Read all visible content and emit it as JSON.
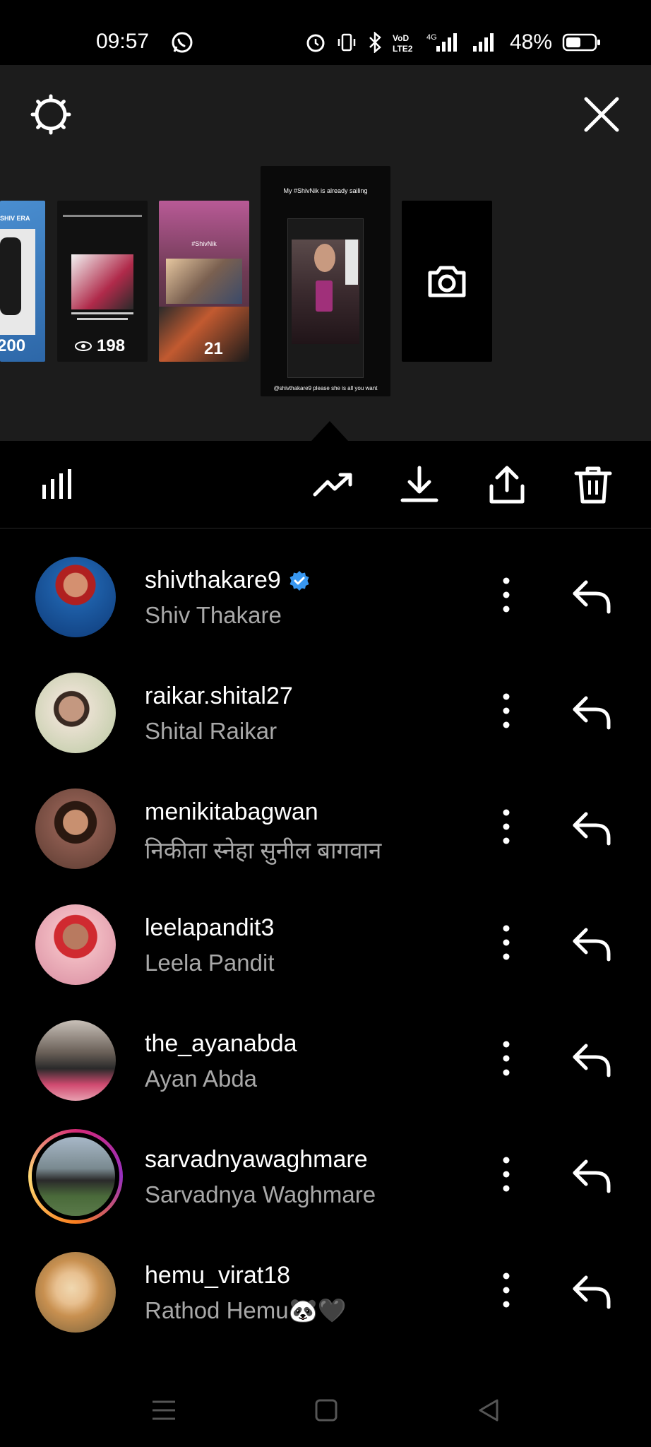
{
  "status_bar": {
    "time": "09:57",
    "battery_percent": "48%",
    "icons": [
      "whatsapp-icon",
      "alarm-icon",
      "vibrate-icon",
      "bluetooth-icon",
      "volte-icon",
      "4g-signal-icon",
      "signal-icon",
      "battery-icon"
    ],
    "network_label": "4G",
    "volte_label": "VoLTE2"
  },
  "story_panel": {
    "thumbnails": [
      {
        "id": "thumb-1",
        "view_count": "200",
        "caption": "SHIV ERA"
      },
      {
        "id": "thumb-2",
        "view_count": "198"
      },
      {
        "id": "thumb-3",
        "view_count": "21",
        "caption": "#ShivNik"
      },
      {
        "id": "thumb-4",
        "caption_top": "My #ShivNik is already sailing",
        "caption_bottom": "@shivthakare9 please she is all you want"
      },
      {
        "id": "thumb-5",
        "icon": "camera-icon"
      }
    ]
  },
  "action_bar": {
    "icons": [
      "insights-bars-icon",
      "trending-icon",
      "download-icon",
      "share-icon",
      "delete-icon"
    ]
  },
  "viewers": [
    {
      "username": "shivthakare9",
      "full_name": "Shiv Thakare",
      "verified": true,
      "ring": false,
      "avatar_color": "#1e5fa8"
    },
    {
      "username": "raikar.shital27",
      "full_name": "Shital Raikar",
      "verified": false,
      "ring": false,
      "avatar_color": "#c8b8a0"
    },
    {
      "username": "menikitabagwan",
      "full_name": "निकीता  स्नेहा सुनील  बागवान",
      "verified": false,
      "ring": false,
      "avatar_color": "#7a4a3e"
    },
    {
      "username": "leelapandit3",
      "full_name": "Leela Pandit",
      "verified": false,
      "ring": false,
      "avatar_color": "#d88ca0"
    },
    {
      "username": "the_ayanabda",
      "full_name": "Ayan Abda",
      "verified": false,
      "ring": false,
      "avatar_color": "#8a7a70"
    },
    {
      "username": "sarvadnyawaghmare",
      "full_name": "Sarvadnya Waghmare",
      "verified": false,
      "ring": true,
      "avatar_color": "#6e8a6a"
    },
    {
      "username": "hemu_virat18",
      "full_name": "Rathod Hemu🐼🖤",
      "verified": false,
      "ring": false,
      "avatar_color": "#c8a060"
    }
  ],
  "nav_bar": {
    "icons": [
      "menu-icon",
      "home-icon",
      "back-icon"
    ]
  }
}
